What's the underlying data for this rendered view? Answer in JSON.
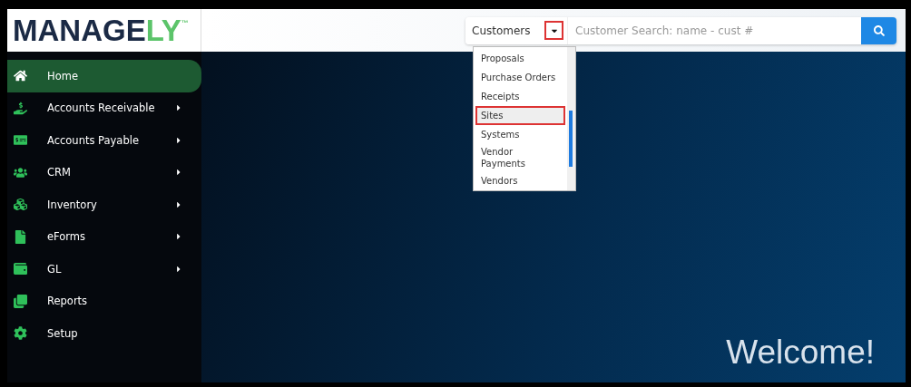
{
  "logo": {
    "text": "MANAGE",
    "accent": "LY",
    "mark": "™"
  },
  "search": {
    "category": "Customers",
    "toggle_highlighted": true,
    "placeholder": "Customer Search: name - cust #"
  },
  "dropdown": {
    "items": [
      {
        "label": "Proposals",
        "selected": false
      },
      {
        "label": "Purchase Orders",
        "selected": false
      },
      {
        "label": "Receipts",
        "selected": false
      },
      {
        "label": "Sites",
        "selected": true
      },
      {
        "label": "Systems",
        "selected": false
      },
      {
        "label": "Vendor Payments",
        "selected": false
      },
      {
        "label": "Vendors",
        "selected": false
      }
    ]
  },
  "sidebar": {
    "items": [
      {
        "label": "Home",
        "selected": true,
        "has_submenu": false
      },
      {
        "label": "Accounts Receivable",
        "selected": false,
        "has_submenu": true
      },
      {
        "label": "Accounts Payable",
        "selected": false,
        "has_submenu": true
      },
      {
        "label": "CRM",
        "selected": false,
        "has_submenu": true
      },
      {
        "label": "Inventory",
        "selected": false,
        "has_submenu": true
      },
      {
        "label": "eForms",
        "selected": false,
        "has_submenu": true
      },
      {
        "label": "GL",
        "selected": false,
        "has_submenu": true
      },
      {
        "label": "Reports",
        "selected": false,
        "has_submenu": false
      },
      {
        "label": "Setup",
        "selected": false,
        "has_submenu": false
      }
    ]
  },
  "welcome": "Welcome!"
}
